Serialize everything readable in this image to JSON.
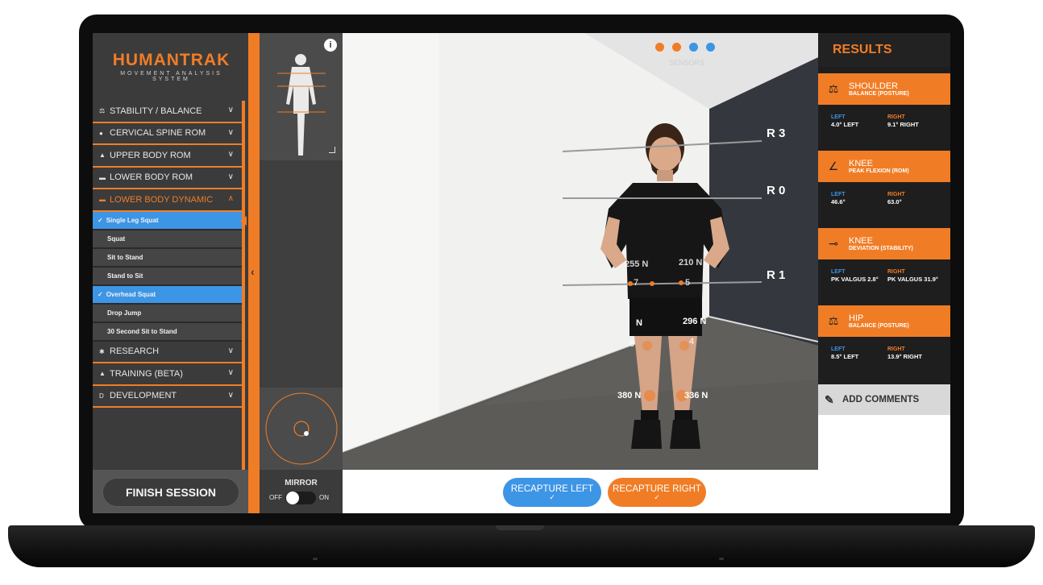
{
  "app": {
    "logo_main": "HUMANTRAK",
    "logo_sub": "MOVEMENT ANALYSIS SYSTEM"
  },
  "sidebar": {
    "categories_top": [
      {
        "label": "STABILITY / BALANCE",
        "icon": "balance-icon"
      },
      {
        "label": "CERVICAL SPINE ROM",
        "icon": "head-icon"
      },
      {
        "label": "UPPER BODY ROM",
        "icon": "arm-icon"
      },
      {
        "label": "LOWER BODY ROM",
        "icon": "leg-icon"
      },
      {
        "label": "LOWER BODY DYNAMIC",
        "icon": "dynamic-icon",
        "active": true
      }
    ],
    "sub_items": [
      {
        "label": "Single Leg Squat",
        "selected": true
      },
      {
        "label": "Squat",
        "selected": false
      },
      {
        "label": "Sit to Stand",
        "selected": false
      },
      {
        "label": "Stand to Sit",
        "selected": false
      },
      {
        "label": "Overhead Squat",
        "selected": true
      },
      {
        "label": "Drop Jump",
        "selected": false
      },
      {
        "label": "30 Second Sit to Stand",
        "selected": false
      }
    ],
    "categories_bottom": [
      {
        "label": "RESEARCH",
        "icon": "gear-icon"
      },
      {
        "label": "TRAINING (BETA)",
        "icon": "training-icon"
      },
      {
        "label": "DEVELOPMENT",
        "icon": "dev-icon"
      }
    ],
    "finish_label": "FINISH SESSION"
  },
  "mirror": {
    "label": "MIRROR",
    "off": "OFF",
    "on": "ON",
    "enabled": false
  },
  "camera": {
    "sensors_label": "SENSORS",
    "lines": [
      {
        "label": "R 3"
      },
      {
        "label": "R 0"
      },
      {
        "label": "R 1"
      }
    ],
    "forces": {
      "left_hand": "255 N",
      "right_hand": "210 N",
      "left_hand_val": "7",
      "right_hand_val": "5",
      "left_knee": "N",
      "right_knee": "296 N",
      "left_knee_val": "6",
      "right_knee_val": "4",
      "left_foot": "380 N",
      "right_foot": "336 N"
    }
  },
  "bottom": {
    "recapture_left": "RECAPTURE LEFT",
    "recapture_right": "RECAPTURE RIGHT",
    "tick": "✓"
  },
  "results": {
    "title": "RESULTS",
    "cards": [
      {
        "name": "SHOULDER",
        "sub": "BALANCE (POSTURE)",
        "icon": "scale-icon",
        "left_label": "LEFT",
        "left_value": "4.0° LEFT",
        "right_label": "RIGHT",
        "right_value": "9.1° RIGHT"
      },
      {
        "name": "KNEE",
        "sub": "PEAK FLEXION (ROM)",
        "icon": "angle-icon",
        "left_label": "LEFT",
        "left_value": "46.6°",
        "right_label": "RIGHT",
        "right_value": "63.0°"
      },
      {
        "name": "KNEE",
        "sub": "DEVIATION (STABILITY)",
        "icon": "deviation-icon",
        "left_label": "LEFT",
        "left_value": "PK VALGUS 2.8°",
        "right_label": "RIGHT",
        "right_value": "PK VALGUS 31.9°"
      },
      {
        "name": "HIP",
        "sub": "BALANCE (POSTURE)",
        "icon": "scale-icon",
        "left_label": "LEFT",
        "left_value": "8.5° LEFT",
        "right_label": "RIGHT",
        "right_value": "13.9° RIGHT"
      }
    ],
    "add_comments": "ADD COMMENTS"
  }
}
